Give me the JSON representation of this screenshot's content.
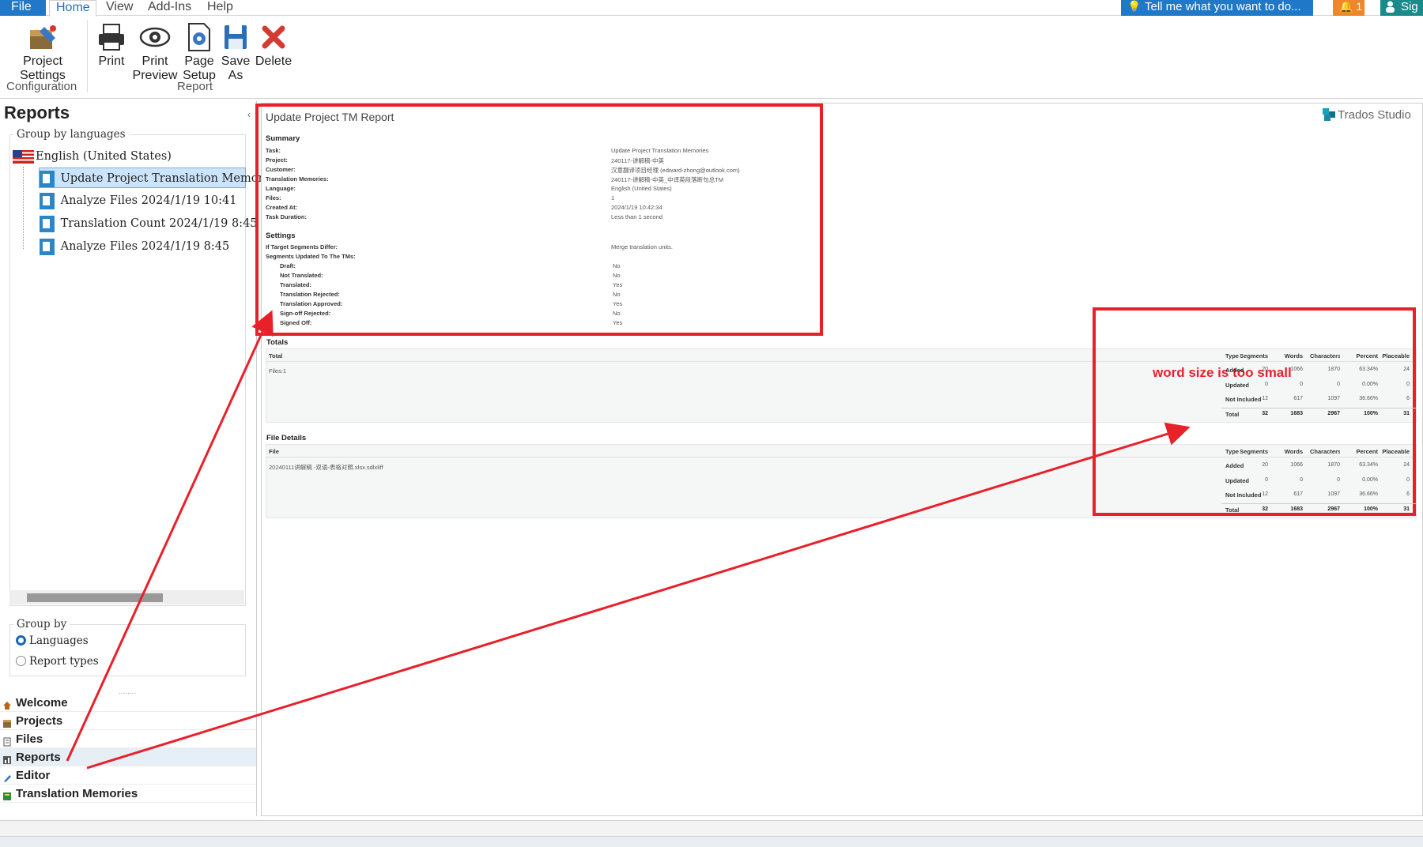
{
  "tabs": {
    "file": "File",
    "home": "Home",
    "view": "View",
    "addins": "Add-Ins",
    "help": "Help"
  },
  "tellme": "Tell me what you want to do...",
  "notifications": "1",
  "signin": "Sig",
  "ribbon": {
    "project_settings": [
      "Project",
      "Settings"
    ],
    "print": "Print",
    "print_preview": [
      "Print",
      "Preview"
    ],
    "page_setup": [
      "Page",
      "Setup"
    ],
    "save_as": [
      "Save",
      "As"
    ],
    "delete": "Delete",
    "group_configuration": "Configuration",
    "group_report": "Report"
  },
  "left": {
    "title": "Reports",
    "collapse": "‹",
    "group_by_languages": "Group by languages",
    "language": "English (United States)",
    "reports": [
      "Update Project Translation Memor",
      "Analyze Files 2024/1/19 10:41",
      "Translation Count 2024/1/19 8:45",
      "Analyze Files 2024/1/19 8:45"
    ],
    "group_by": "Group by",
    "opt_languages": "Languages",
    "opt_report_types": "Report types",
    "splitter": "........"
  },
  "nav": [
    "Welcome",
    "Projects",
    "Files",
    "Reports",
    "Editor",
    "Translation Memories"
  ],
  "report": {
    "title": "Update Project TM Report",
    "brand": "Trados Studio",
    "summary_heading": "Summary",
    "summary": [
      {
        "label": "Task:",
        "value": "Update Project Translation Memories"
      },
      {
        "label": "Project:",
        "value": "240117-讲解稿-中英"
      },
      {
        "label": "Customer:",
        "value": "汉意翻译项目经理 (edward-zhong@outlook.com)"
      },
      {
        "label": "Translation Memories:",
        "value": "240117-讲解稿-中英_中译英段落断句总TM"
      },
      {
        "label": "Language:",
        "value": "English (United States)"
      },
      {
        "label": "Files:",
        "value": "1"
      },
      {
        "label": "Created At:",
        "value": "2024/1/19 10:42:34"
      },
      {
        "label": "Task Duration:",
        "value": "Less than 1 second"
      }
    ],
    "settings_heading": "Settings",
    "settings_top": [
      {
        "label": "If Target Segments Differ:",
        "value": "Merge translation units."
      },
      {
        "label": "Segments Updated To The TMs:",
        "value": ""
      }
    ],
    "settings_sub": [
      {
        "label": "Draft:",
        "value": "No"
      },
      {
        "label": "Not Translated:",
        "value": "No"
      },
      {
        "label": "Translated:",
        "value": "Yes"
      },
      {
        "label": "Translation Rejected:",
        "value": "No"
      },
      {
        "label": "Translation Approved:",
        "value": "Yes"
      },
      {
        "label": "Sign-off Rejected:",
        "value": "No"
      },
      {
        "label": "Signed Off:",
        "value": "Yes"
      }
    ],
    "totals_heading": "Totals",
    "totals_col": "Total",
    "totals_row": "Files:1",
    "columns": [
      "Type",
      "Segments",
      "Words",
      "Characters",
      "Percent",
      "Placeable"
    ],
    "totals_rows": [
      {
        "type": "Added",
        "seg": "20",
        "words": "1066",
        "chars": "1870",
        "pct": "63.34%",
        "plc": "24"
      },
      {
        "type": "Updated",
        "seg": "0",
        "words": "0",
        "chars": "0",
        "pct": "0.00%",
        "plc": "0"
      },
      {
        "type": "Not Included",
        "seg": "12",
        "words": "617",
        "chars": "1097",
        "pct": "36.66%",
        "plc": "6"
      },
      {
        "type": "Total",
        "seg": "32",
        "words": "1683",
        "chars": "2967",
        "pct": "100%",
        "plc": "31"
      }
    ],
    "filedetails_heading": "File Details",
    "file_col": "File",
    "file_name": "20240111讲解稿 -双语-表格对照.xlsx.sdlxliff",
    "annotation": "word size is too small"
  },
  "colors": {
    "accent": "#1f78c8",
    "highlight": "#e8202a"
  }
}
